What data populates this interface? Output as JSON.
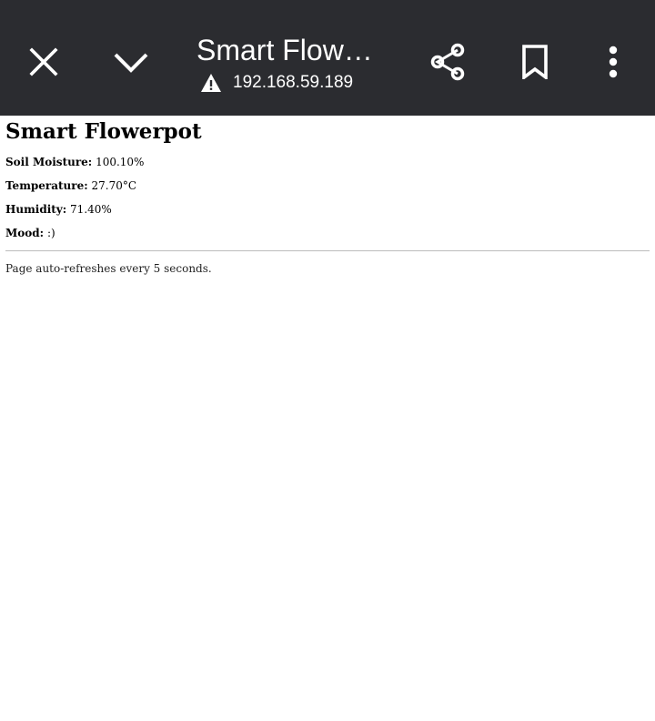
{
  "toolbar": {
    "title": "Smart Flowe...",
    "url": "192.168.59.189",
    "icons": {
      "close": "close-icon",
      "minimize": "chevron-down-icon",
      "warning": "warning-icon",
      "share": "share-icon",
      "bookmark": "bookmark-icon",
      "menu": "more-vert-icon"
    },
    "background_color": "#2b2c30"
  },
  "page": {
    "heading": "Smart Flowerpot",
    "soil_moisture_label": "Soil Moisture:",
    "soil_moisture_value": "100.10%",
    "temperature_label": "Temperature:",
    "temperature_value": "27.70°C",
    "humidity_label": "Humidity:",
    "humidity_value": "71.40%",
    "mood_label": "Mood:",
    "mood_value": ":)",
    "note": "Page auto-refreshes every 5 seconds."
  }
}
